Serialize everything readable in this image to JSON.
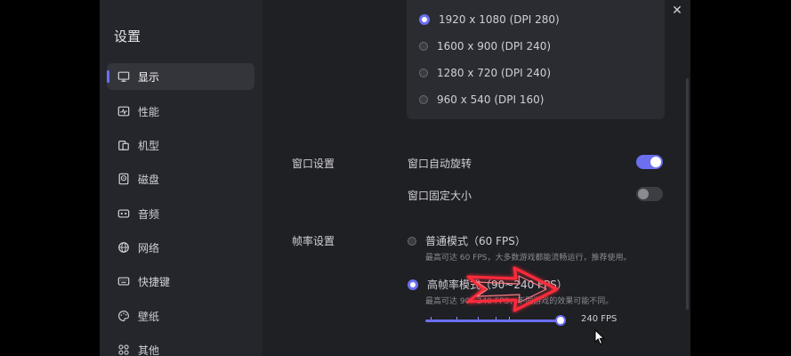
{
  "sidebar": {
    "title": "设置",
    "items": [
      {
        "label": "显示",
        "icon": "monitor-icon",
        "active": true
      },
      {
        "label": "性能",
        "icon": "performance-icon"
      },
      {
        "label": "机型",
        "icon": "device-icon"
      },
      {
        "label": "磁盘",
        "icon": "disk-icon"
      },
      {
        "label": "音频",
        "icon": "audio-icon"
      },
      {
        "label": "网络",
        "icon": "globe-icon"
      },
      {
        "label": "快捷键",
        "icon": "keyboard-icon"
      },
      {
        "label": "壁纸",
        "icon": "palette-icon"
      },
      {
        "label": "其他",
        "icon": "grid-icon"
      }
    ]
  },
  "resolution": {
    "options": [
      {
        "label": "1920 x 1080 (DPI 280)",
        "selected": true
      },
      {
        "label": "1600 x 900 (DPI 240)",
        "selected": false
      },
      {
        "label": "1280 x 720 (DPI 240)",
        "selected": false
      },
      {
        "label": "960 x 540 (DPI 160)",
        "selected": false
      }
    ]
  },
  "window_settings": {
    "section_label": "窗口设置",
    "auto_rotate_label": "窗口自动旋转",
    "auto_rotate_on": true,
    "fixed_size_label": "窗口固定大小",
    "fixed_size_on": false
  },
  "frame_rate": {
    "section_label": "帧率设置",
    "normal_label": "普通模式（60 FPS）",
    "normal_hint": "最高可达 60 FPS，大多数游戏都能流畅运行，推荐使用。",
    "normal_selected": false,
    "high_label": "高帧率模式（90~240 FPS）",
    "high_hint": "最高可达 90~240 FPS，不同游戏的效果可能不同。",
    "high_selected": true,
    "slider_value": 240,
    "slider_min": 90,
    "slider_max": 240,
    "slider_value_label": "240 FPS"
  },
  "colors": {
    "accent": "#6b6ff0",
    "window_bg": "#1f2024",
    "sidebar_bg": "#25262b",
    "arrow": "#ff2a3a"
  }
}
